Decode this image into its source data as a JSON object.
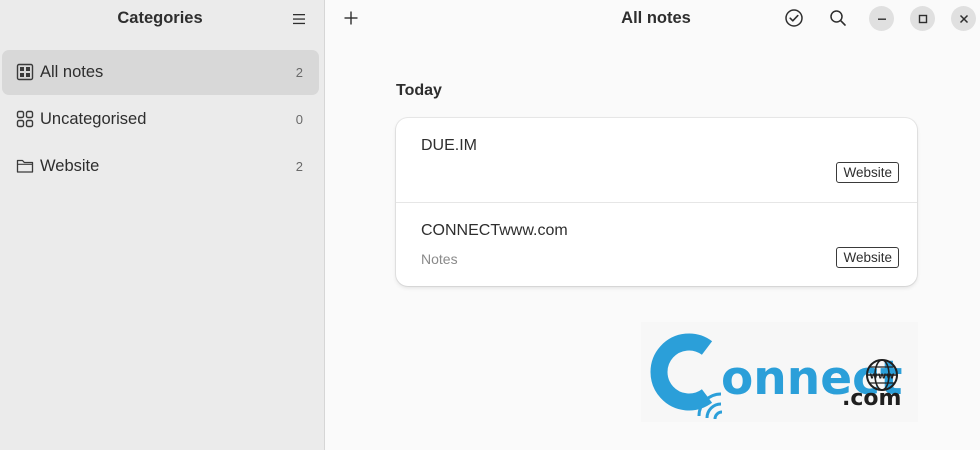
{
  "sidebar": {
    "title": "Categories",
    "menu_icon": "hamburger-menu-icon",
    "items": [
      {
        "label": "All notes",
        "count": "2",
        "icon": "all-notes-icon",
        "selected": true
      },
      {
        "label": "Uncategorised",
        "count": "0",
        "icon": "grid-icon",
        "selected": false
      },
      {
        "label": "Website",
        "count": "2",
        "icon": "folder-icon",
        "selected": false
      }
    ]
  },
  "header": {
    "title": "All notes",
    "add_icon": "plus-icon",
    "select_icon": "checkmark-circle-icon",
    "search_icon": "search-icon",
    "minimize_icon": "minimize-icon",
    "maximize_icon": "maximize-icon",
    "close_icon": "close-icon"
  },
  "notes": {
    "section_title": "Today",
    "items": [
      {
        "title": "DUE.IM",
        "subtitle": "",
        "category": "Website"
      },
      {
        "title": "CONNECTwww.com",
        "subtitle": "Notes",
        "category": "Website"
      }
    ]
  },
  "watermark": {
    "text_main": "onnect",
    "text_com": ".com",
    "text_www": "www",
    "color_blue": "#2b9fd9",
    "color_dark": "#1f1f1f"
  }
}
